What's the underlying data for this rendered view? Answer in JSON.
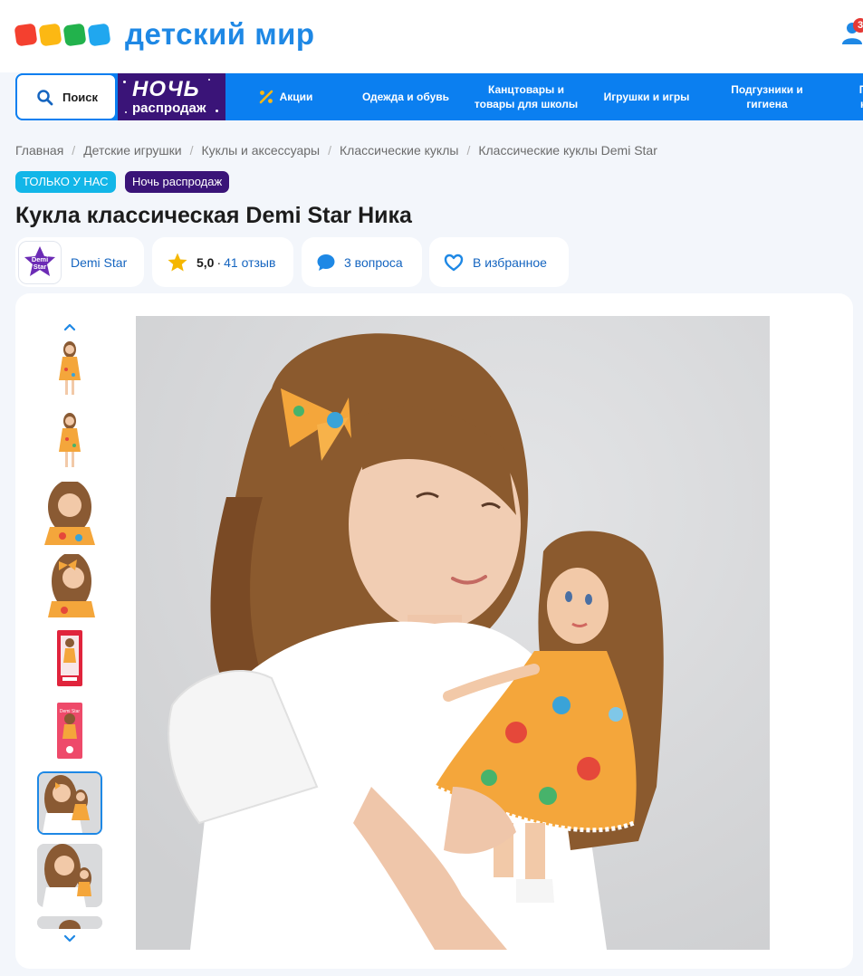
{
  "brand": {
    "logo_text": "детский мир",
    "logo_colors": [
      "#f4402f",
      "#fcb813",
      "#22b24c",
      "#20a7ef"
    ],
    "cart_badge": "3"
  },
  "nav": {
    "search_label": "Поиск",
    "promo": {
      "line1": "НОЧЬ",
      "line2": "распродаж"
    },
    "items": [
      "Акции",
      "Одежда и обувь",
      "Канцтовары и товары для школы",
      "Игрушки и игры",
      "Подгузники и гигиена",
      "П… к…"
    ]
  },
  "breadcrumb": [
    "Главная",
    "Детские игрушки",
    "Куклы и аксессуары",
    "Классические куклы",
    "Классические куклы Demi Star"
  ],
  "tags": [
    "ТОЛЬКО У НАС",
    "Ночь распродаж"
  ],
  "product": {
    "title": "Кукла классическая Demi Star Ника",
    "brand_name": "Demi Star",
    "brand_logo_text": "Demi Star",
    "rating": "5,0",
    "rating_sep": "·",
    "reviews": "41 отзыв",
    "questions": "3 вопроса",
    "favorite": "В избранное"
  },
  "gallery": {
    "thumbnail_count": 9,
    "active_thumbnail": 7
  },
  "colors": {
    "accent": "#0b7ff0",
    "tag_only": "#12b6e8",
    "tag_night": "#3a1478",
    "star": "#f5b700"
  },
  "icons": [
    "search-icon",
    "percent-icon",
    "user-icon",
    "star-icon",
    "chat-icon",
    "heart-icon",
    "chevron-up-icon",
    "chevron-down-icon"
  ]
}
